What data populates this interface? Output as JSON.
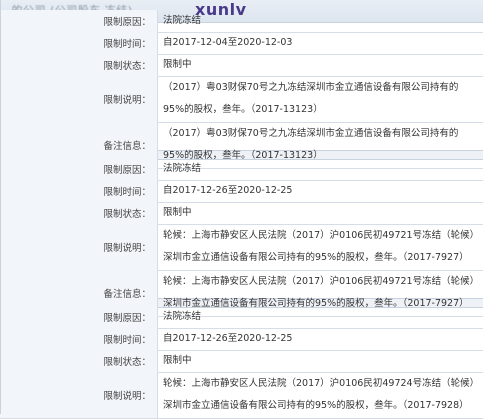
{
  "header": {
    "blurred_title": "…的公司 (公司股东 冻结)…",
    "logo": "xunlv"
  },
  "sections": [
    {
      "rows": [
        {
          "label": "限制原因：",
          "value": "法院冻结"
        },
        {
          "label": "限制时间：",
          "value": "自2017-12-04至2020-12-03"
        },
        {
          "label": "限制状态：",
          "value": "限制中"
        },
        {
          "label": "限制说明：",
          "value": "（2017）粤03财保70号之九冻结深圳市金立通信设备有限公司持有的95%的股权，叁年。（2017-13123）"
        },
        {
          "label": "备注信息：",
          "value": "（2017）粤03财保70号之九冻结深圳市金立通信设备有限公司持有的95%的股权，叁年。（2017-13123）"
        }
      ]
    },
    {
      "rows": [
        {
          "label": "限制原因：",
          "value": "法院冻结"
        },
        {
          "label": "限制时间：",
          "value": "自2017-12-26至2020-12-25"
        },
        {
          "label": "限制状态：",
          "value": "限制中"
        },
        {
          "label": "限制说明：",
          "value": "轮候：上海市静安区人民法院（2017）沪0106民初49721号冻结（轮候）深圳市金立通信设备有限公司持有的95%的股权，叁年。（2017-7927）"
        },
        {
          "label": "备注信息：",
          "value": "轮候：上海市静安区人民法院（2017）沪0106民初49721号冻结（轮候）深圳市金立通信设备有限公司持有的95%的股权，叁年。（2017-7927）"
        }
      ]
    },
    {
      "rows": [
        {
          "label": "限制原因：",
          "value": "法院冻结"
        },
        {
          "label": "限制时间：",
          "value": "自2017-12-26至2020-12-25"
        },
        {
          "label": "限制状态：",
          "value": "限制中"
        },
        {
          "label": "限制说明：",
          "value": "轮候：上海市静安区人民法院（2017）沪0106民初49724号冻结（轮候）深圳市金立通信设备有限公司持有的95%的股权，叁年。（2017-7928）"
        }
      ]
    }
  ]
}
